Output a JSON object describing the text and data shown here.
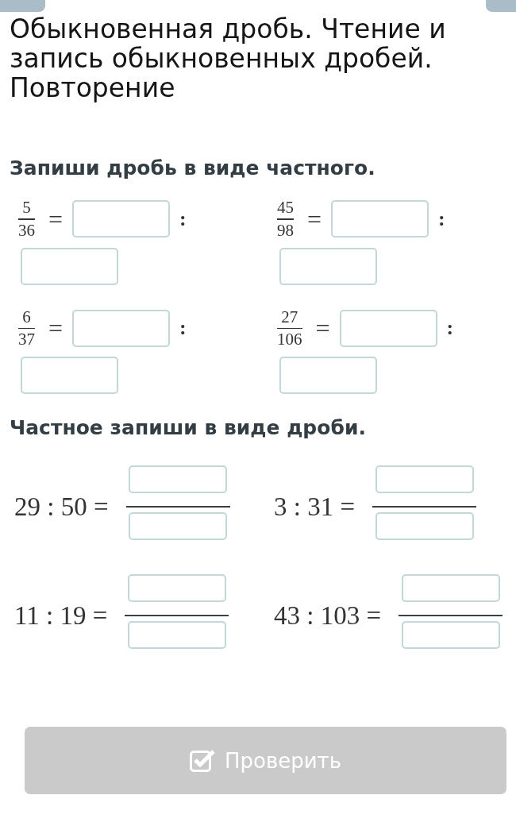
{
  "title": "Обыкновенная дробь. Чтение и запись обыкновенных дробей. Повторение",
  "sections": [
    {
      "kind": "fraction-to-quotient",
      "heading": "Запиши дробь в виде частного.",
      "problems": [
        {
          "numerator": "5",
          "denominator": "36",
          "equals_sign": "=",
          "colon": ":"
        },
        {
          "numerator": "45",
          "denominator": "98",
          "equals_sign": "=",
          "colon": ":"
        },
        {
          "numerator": "6",
          "denominator": "37",
          "equals_sign": "=",
          "colon": ":"
        },
        {
          "numerator": "27",
          "denominator": "106",
          "equals_sign": "=",
          "colon": ":"
        }
      ]
    },
    {
      "kind": "quotient-to-fraction",
      "heading": "Частное запиши в виде дроби.",
      "problems": [
        {
          "expression": "29 : 50 ="
        },
        {
          "expression": "3 : 31 ="
        },
        {
          "expression": "11 : 19 ="
        },
        {
          "expression": "43 : 103 ="
        }
      ]
    }
  ],
  "check_button": {
    "label": "Проверить",
    "disabled": true
  }
}
